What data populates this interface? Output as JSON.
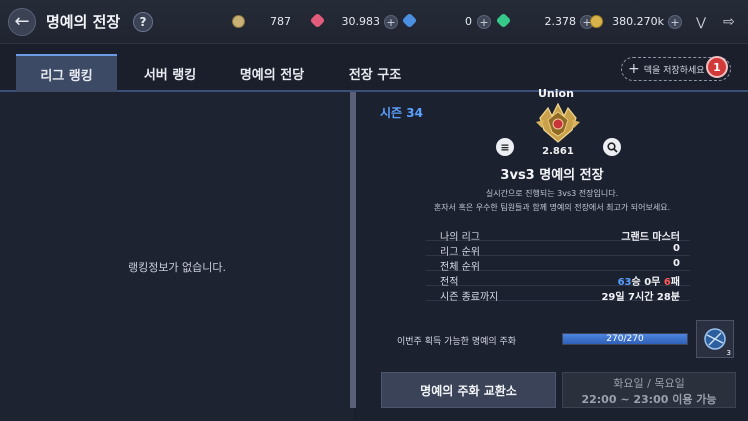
{
  "header": {
    "title": "명예의 전장",
    "help_label": "?",
    "currencies": [
      {
        "icon": "coin-stack-icon",
        "value": "787",
        "color": "#c9b074"
      },
      {
        "icon": "pink-gem-icon",
        "value": "30.983",
        "color": "#e25b7a"
      },
      {
        "icon": "blue-crystal-icon",
        "value": "0",
        "color": "#4a8fe0"
      },
      {
        "icon": "green-gem-icon",
        "value": "2.378",
        "color": "#37c98a"
      },
      {
        "icon": "gold-coin-icon",
        "value": "380.270k",
        "color": "#d8b24a"
      }
    ]
  },
  "tabs": [
    {
      "label": "리그 랭킹",
      "active": true
    },
    {
      "label": "서버 랭킹",
      "active": false
    },
    {
      "label": "명예의 전당",
      "active": false
    },
    {
      "label": "전장 구조",
      "active": false
    }
  ],
  "deck": {
    "save_label": "덱을 저장하세요",
    "badge": "1"
  },
  "left": {
    "empty_message": "랭킹정보가 없습니다."
  },
  "right": {
    "season": "시즌 34",
    "union_name": "Union",
    "score": "2.861",
    "mode_title": "3vs3 명예의 전장",
    "desc_line1": "실시간으로 진행되는 3vs3 전장입니다.",
    "desc_line2": "혼자서 혹은 우수한 팀원들과 함께 명예의 전장에서 최고가 되어보세요.",
    "stats": {
      "my_league_label": "나의 리그",
      "my_league_value": "그랜드 마스터",
      "league_rank_label": "리그 순위",
      "league_rank_value": "0",
      "total_rank_label": "전체 순위",
      "total_rank_value": "0",
      "record_label": "전적",
      "record_wins": "63",
      "record_wins_suffix": "승 ",
      "record_draws": "0무 ",
      "record_losses": "6",
      "record_losses_suffix": "패",
      "season_end_label": "시즌 종료까지",
      "season_end_value": "29일 7시간 28분"
    },
    "coin_label": "이번주 획득 가능한 명예의 주화",
    "coin_progress_text": "270/270",
    "coin_progress_fraction": 1.0,
    "item_count": "3",
    "exchange_label": "명예의 주화 교환소",
    "schedule_days": "화요일 / 목요일",
    "schedule_time": "22:00 ~ 23:00 이용 가능"
  }
}
